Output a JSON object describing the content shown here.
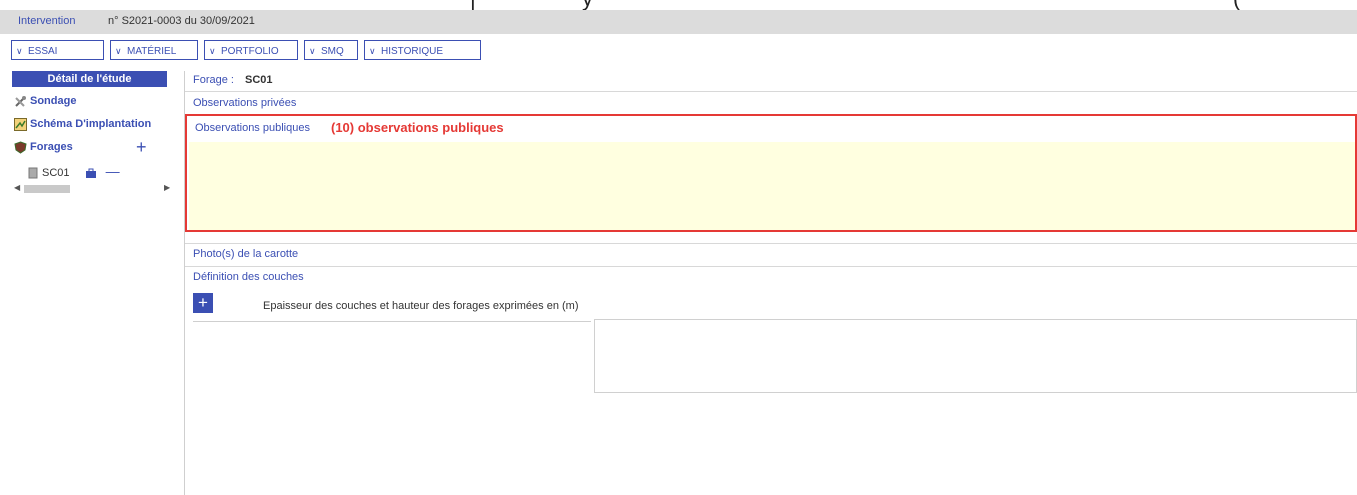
{
  "header": {
    "crumb": "Intervention",
    "reference": "n° S2021-0003 du 30/09/2021"
  },
  "tabs": [
    "ESSAI",
    "MATÉRIEL",
    "PORTFOLIO",
    "SMQ",
    "HISTORIQUE"
  ],
  "sidebar": {
    "title": "Détail de l'étude",
    "items": [
      {
        "label": "Sondage"
      },
      {
        "label": "Schéma D'implantation"
      },
      {
        "label": "Forages"
      }
    ],
    "sub_item": "SC01",
    "add_symbol": "+"
  },
  "main": {
    "forage_label": "Forage :",
    "forage_value": "SC01",
    "obs_privees": "Observations privées",
    "obs_publiques": "Observations publiques",
    "obs_annotation": "(10) observations publiques",
    "photos": "Photo(s) de la carotte",
    "definition": "Définition des couches",
    "add_button": "+",
    "epaisseur_note": "Epaisseur des couches et hauteur des forages exprimées en (m)"
  },
  "colors": {
    "accent": "#3b4fb3",
    "annotation": "#e53935",
    "obs_background": "#ffffe0"
  }
}
